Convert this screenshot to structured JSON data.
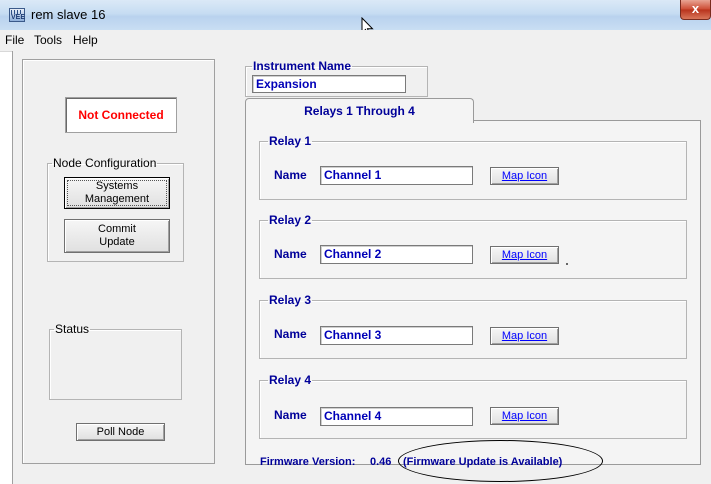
{
  "window": {
    "title": "rem slave 16",
    "close_glyph": "x",
    "app_icon_text": "VEE"
  },
  "menu": {
    "items": [
      "File",
      "Tools",
      "Help"
    ]
  },
  "left": {
    "connection_status": "Not Connected",
    "node_config_label": "Node Configuration",
    "systems_button_line1": "Systems",
    "systems_button_line2": "Management",
    "commit_button_line1": "Commit",
    "commit_button_line2": "Update",
    "status_label": "Status",
    "poll_button": "Poll Node"
  },
  "instrument": {
    "label": "Instrument Name",
    "value": "Expansion"
  },
  "tab": {
    "label": "Relays 1 Through 4"
  },
  "relays": [
    {
      "label": "Relay 1",
      "name_label": "Name",
      "name_value": "Channel 1",
      "map_button": "Map Icon"
    },
    {
      "label": "Relay 2",
      "name_label": "Name",
      "name_value": "Channel 2",
      "map_button": "Map Icon"
    },
    {
      "label": "Relay 3",
      "name_label": "Name",
      "name_value": "Channel 3",
      "map_button": "Map Icon"
    },
    {
      "label": "Relay 4",
      "name_label": "Name",
      "name_value": "Channel 4",
      "map_button": "Map Icon"
    }
  ],
  "firmware": {
    "label": "Firmware Version:",
    "version": "0.46",
    "update_notice": "(Firmware Update is Available)"
  },
  "colors": {
    "status_red": "#ff0000",
    "label_navy": "#000099",
    "field_blue": "#0000b8"
  }
}
